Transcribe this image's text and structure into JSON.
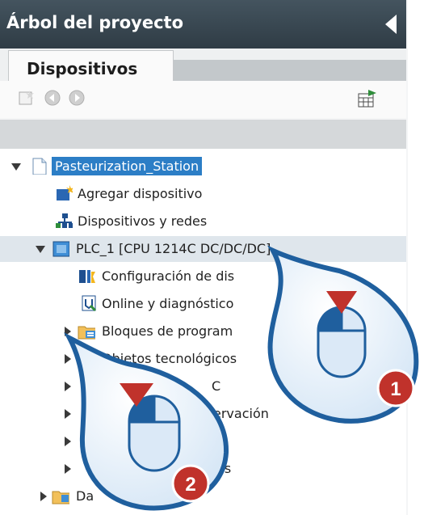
{
  "panel": {
    "title": "Árbol del proyecto",
    "tab": "Dispositivos"
  },
  "tree": {
    "root": "Pasteurization_Station",
    "add_device": "Agregar dispositivo",
    "devices_networks": "Dispositivos y redes",
    "plc": "PLC_1 [CPU 1214C DC/DC/DC]",
    "device_config": "Configuración de dis",
    "online_diag": "Online y diagnóstico",
    "program_blocks": "Bloques de program",
    "tech_objects": "Objetos tecnológicos",
    "item_c": "C",
    "item_observation": "ervación",
    "item_s": "s",
    "item_es": "es",
    "item_da": "Da"
  },
  "callouts": {
    "first": "1",
    "second": "2"
  },
  "colors": {
    "title_bar": "#2f3c45",
    "selection": "#2c7ec6",
    "callout_blue": "#1f5f9e",
    "badge_red": "#c0322b"
  }
}
